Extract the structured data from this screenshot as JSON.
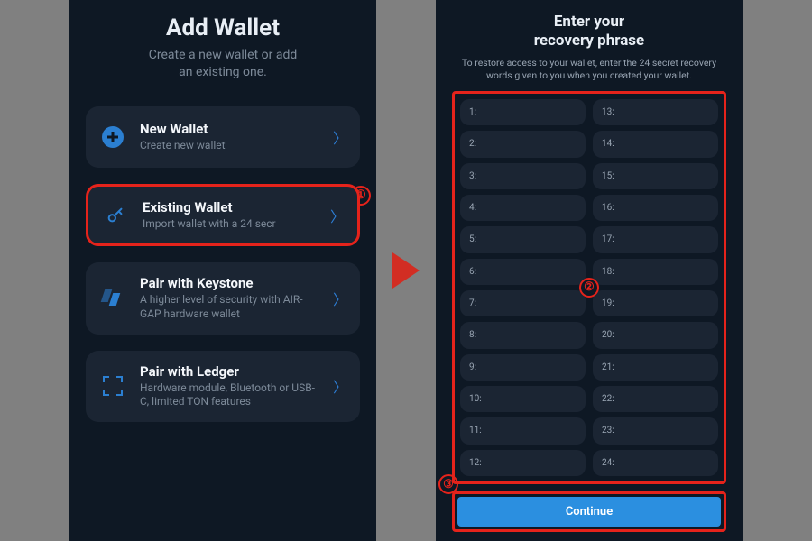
{
  "annotations": {
    "highlight_color": "#e5231b",
    "step1_label": "①",
    "step2_label": "②",
    "step3_label": "③"
  },
  "left_panel": {
    "title": "Add Wallet",
    "subtitle_line1": "Create a new wallet or add",
    "subtitle_line2": "an existing one.",
    "options": [
      {
        "id": "new-wallet",
        "icon": "plus-circle-icon",
        "title": "New Wallet",
        "desc": "Create new wallet",
        "highlighted": false
      },
      {
        "id": "existing-wallet",
        "icon": "key-icon",
        "title": "Existing Wallet",
        "desc": "Import wallet with a 24 secr",
        "highlighted": true
      },
      {
        "id": "pair-keystone",
        "icon": "keystone-icon",
        "title": "Pair with Keystone",
        "desc": "A higher level of security with AIR-GAP hardware wallet",
        "highlighted": false
      },
      {
        "id": "pair-ledger",
        "icon": "ledger-icon",
        "title": "Pair with Ledger",
        "desc": "Hardware module, Bluetooth or USB-C, limited TON features",
        "highlighted": false
      }
    ]
  },
  "right_panel": {
    "title_line1": "Enter your",
    "title_line2": "recovery phrase",
    "subtitle": "To restore access to your wallet, enter the 24 secret recovery words given to you when you created your wallet.",
    "word_count": 24,
    "word_labels": [
      "1:",
      "2:",
      "3:",
      "4:",
      "5:",
      "6:",
      "7:",
      "8:",
      "9:",
      "10:",
      "11:",
      "12:",
      "13:",
      "14:",
      "15:",
      "16:",
      "17:",
      "18:",
      "19:",
      "20:",
      "21:",
      "22:",
      "23:",
      "24:"
    ],
    "continue_label": "Continue"
  },
  "colors": {
    "bg_page": "#808080",
    "bg_phone": "#0e1824",
    "bg_card": "#1b2533",
    "accent": "#2b7fd1",
    "button": "#2b8fe0",
    "text_muted": "#7d8a99"
  }
}
